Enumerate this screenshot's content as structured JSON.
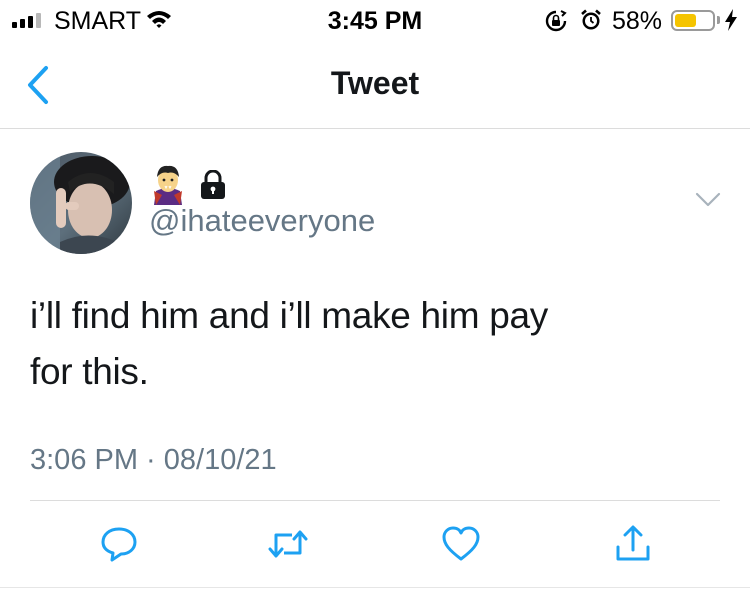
{
  "status_bar": {
    "carrier": "SMART",
    "time": "3:45 PM",
    "battery_percent": "58%",
    "battery_level": 0.58,
    "battery_color": "#f5c400",
    "icons": [
      "signal-icon",
      "wifi-icon",
      "rotation-lock-icon",
      "alarm-icon",
      "battery-icon",
      "charging-icon"
    ]
  },
  "nav": {
    "title": "Tweet",
    "back_icon": "chevron-left-icon",
    "accent": "#1da1f2"
  },
  "tweet": {
    "display_name_icons": [
      "vampire-emoji",
      "lock-icon"
    ],
    "handle": "@ihateeveryone",
    "text_line1": "i’ll find him and i’ll make him pay",
    "text_line2": "for this.",
    "timestamp": "3:06 PM · 08/10/21",
    "menu_icon": "chevron-down-icon"
  },
  "actions": [
    {
      "name": "reply",
      "icon": "reply-icon"
    },
    {
      "name": "retweet",
      "icon": "retweet-icon"
    },
    {
      "name": "like",
      "icon": "heart-icon"
    },
    {
      "name": "share",
      "icon": "share-icon"
    }
  ],
  "colors": {
    "text": "#14171a",
    "secondary_text": "#657786",
    "action_icon": "#1da1f2"
  }
}
